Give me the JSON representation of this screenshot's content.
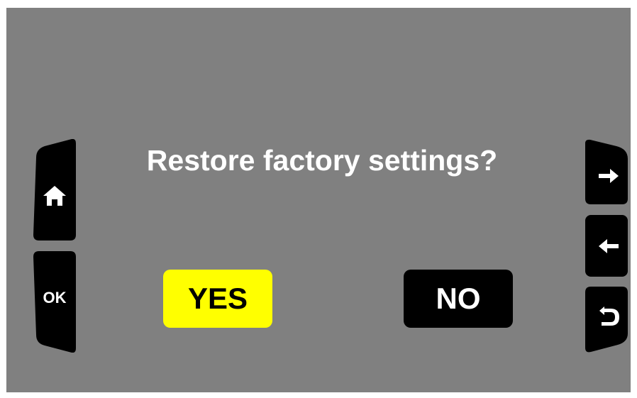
{
  "dialog": {
    "prompt": "Restore factory settings?"
  },
  "buttons": {
    "yes_label": "YES",
    "no_label": "NO"
  },
  "left_keys": [
    {
      "icon": "home-icon"
    },
    {
      "icon": "ok-icon",
      "label": "OK"
    }
  ],
  "right_keys": [
    {
      "icon": "arrow-right-icon"
    },
    {
      "icon": "arrow-left-icon"
    },
    {
      "icon": "back-icon"
    }
  ],
  "colors": {
    "background": "#808080",
    "selected_button": "#ffff00",
    "unselected_button": "#000000",
    "text": "#ffffff"
  }
}
